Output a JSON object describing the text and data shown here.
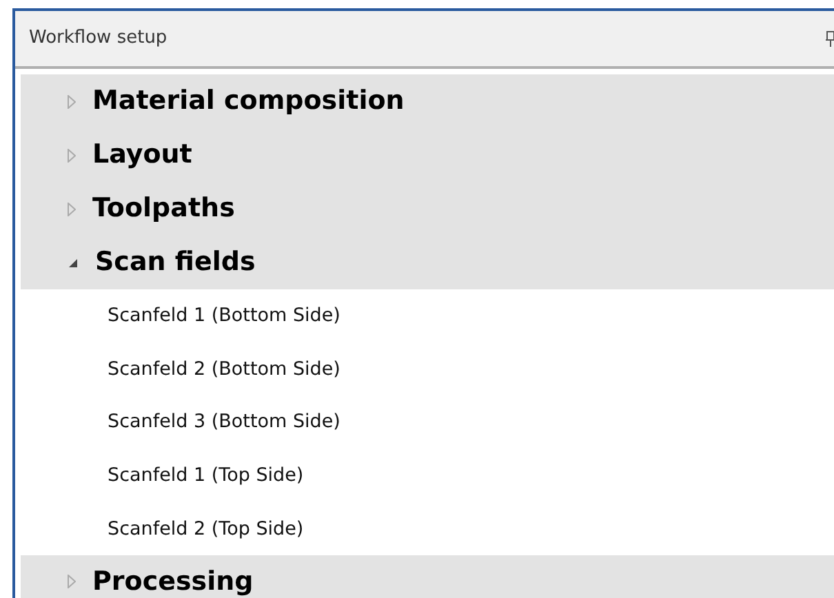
{
  "panel": {
    "title": "Workflow setup"
  },
  "tree": [
    {
      "label": "Material composition",
      "expanded": false
    },
    {
      "label": "Layout",
      "expanded": false
    },
    {
      "label": "Toolpaths",
      "expanded": false
    },
    {
      "label": "Scan fields",
      "expanded": true,
      "children": [
        {
          "label": "Scanfeld 1 (Bottom Side)"
        },
        {
          "label": "Scanfeld 2 (Bottom Side)"
        },
        {
          "label": "Scanfeld 3 (Bottom Side)"
        },
        {
          "label": "Scanfeld 1 (Top Side)"
        },
        {
          "label": "Scanfeld 2 (Top Side)"
        }
      ]
    },
    {
      "label": "Processing",
      "expanded": false
    }
  ]
}
